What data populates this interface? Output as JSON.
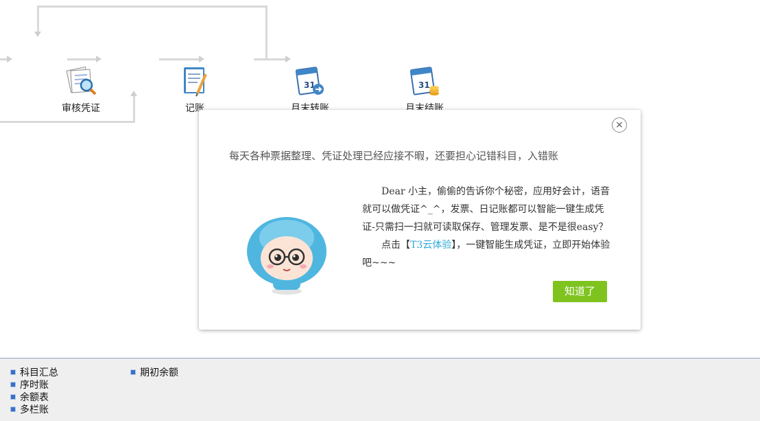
{
  "flow": {
    "nodes": [
      {
        "label": "审核凭证",
        "icon": "audit-voucher-icon"
      },
      {
        "label": "记账",
        "icon": "bookkeeping-icon"
      },
      {
        "label": "月末转账",
        "icon": "month-end-transfer-icon"
      },
      {
        "label": "月末结账",
        "icon": "month-end-closing-icon"
      }
    ]
  },
  "modal": {
    "headline": "每天各种票据整理、凭证处理已经应接不暇，还要担心记错科目，入错账",
    "body_line1": "Dear 小主，偷偷的告诉你个秘密，应用好会计，语音就可以做凭证^_^，发票、日记账都可以智能一键生成凭证-只需扫一扫就可读取保存、管理发票、是不是很easy？",
    "body_click": "点击【",
    "body_link": "T3云体验",
    "body_after": "】，一键智能生成凭证，立即开始体验吧~~~",
    "ok_label": "知道了",
    "close_glyph": "×",
    "mascot_icon": "cartoon-mascot-icon"
  },
  "reports": {
    "col1": [
      "科目汇总",
      "序时账",
      "余额表",
      "多栏账"
    ],
    "col2": [
      "期初余额"
    ]
  },
  "colors": {
    "ok_button": "#7fc31f",
    "link": "#2fa8d6",
    "panel_border": "#9aa2c0"
  }
}
